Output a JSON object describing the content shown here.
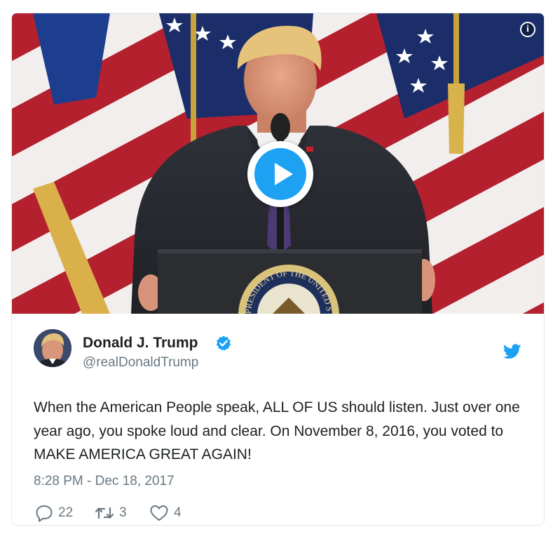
{
  "media": {
    "info_icon": "info-icon",
    "play_icon": "play-icon",
    "colors": {
      "accent": "#1da1f2",
      "flag_red": "#b4202e",
      "podium": "#2b2d31"
    }
  },
  "tweet": {
    "display_name": "Donald J. Trump",
    "username": "@realDonaldTrump",
    "verified": true,
    "text": "When the American People speak, ALL OF US should listen. Just over one year ago, you spoke loud and clear. On November 8, 2016, you voted to MAKE AMERICA GREAT AGAIN!",
    "timestamp": "8:28 PM - Dec 18, 2017",
    "actions": {
      "replies": "22",
      "retweets": "3",
      "likes": "4"
    }
  },
  "seal_text": "PRESIDENT OF THE UNITED STATES",
  "colors": {
    "secondary_text": "#697882",
    "primary_text": "#1c2022",
    "border": "#e1e8ed"
  }
}
